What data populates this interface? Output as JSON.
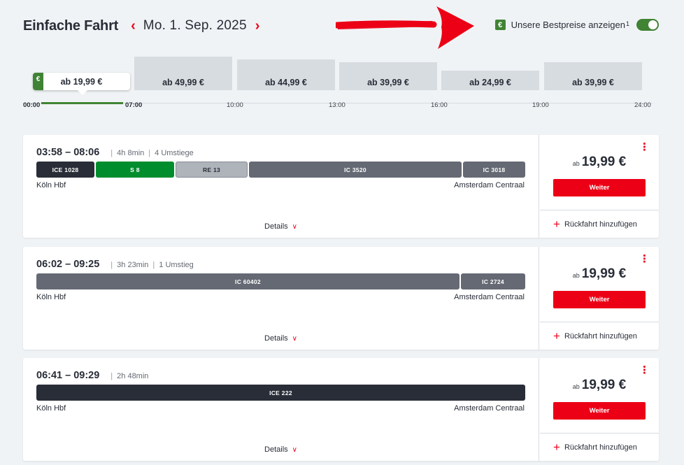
{
  "header": {
    "trip_type": "Einfache Fahrt",
    "date": "Mo. 1. Sep. 2025"
  },
  "bestprice": {
    "label": "Unsere Bestpreise anzeigen",
    "footnote": "1",
    "euro": "€",
    "enabled": true
  },
  "price_bars": [
    {
      "label": "ab 19,99 €",
      "active": true
    },
    {
      "label": "ab 49,99 €"
    },
    {
      "label": "ab 44,99 €"
    },
    {
      "label": "ab 39,99 €"
    },
    {
      "label": "ab 24,99 €"
    },
    {
      "label": "ab 39,99 €"
    }
  ],
  "timeline_ticks": [
    "00:00",
    "07:00",
    "10:00",
    "13:00",
    "16:00",
    "19:00",
    "24:00"
  ],
  "connections": [
    {
      "time": "03:58 – 08:06",
      "duration": "4h 8min",
      "transfers": "4 Umstiege",
      "segments": [
        {
          "name": "ICE 1028",
          "type": "ice"
        },
        {
          "name": "S 8",
          "type": "sb"
        },
        {
          "name": "RE 13",
          "type": "re"
        },
        {
          "name": "IC 3520",
          "type": "ic"
        },
        {
          "name": "IC 3018",
          "type": "ic"
        }
      ],
      "from": "Köln Hbf",
      "to": "Amsterdam Centraal",
      "details": "Details",
      "price_prefix": "ab",
      "price": "19,99 €",
      "button": "Weiter",
      "return": "Rückfahrt hinzufügen"
    },
    {
      "time": "06:02 – 09:25",
      "duration": "3h 23min",
      "transfers": "1 Umstieg",
      "segments": [
        {
          "name": "IC 60402",
          "type": "ic"
        },
        {
          "name": "IC 2724",
          "type": "ic"
        }
      ],
      "from": "Köln Hbf",
      "to": "Amsterdam Centraal",
      "details": "Details",
      "price_prefix": "ab",
      "price": "19,99 €",
      "button": "Weiter",
      "return": "Rückfahrt hinzufügen"
    },
    {
      "time": "06:41 – 09:29",
      "duration": "2h 48min",
      "transfers": "",
      "segments": [
        {
          "name": "ICE 222",
          "type": "ice"
        }
      ],
      "from": "Köln Hbf",
      "to": "Amsterdam Centraal",
      "details": "Details",
      "price_prefix": "ab",
      "price": "19,99 €",
      "button": "Weiter",
      "return": "Rückfahrt hinzufügen"
    }
  ],
  "colors": {
    "db_red": "#ec0016",
    "bestprice_green": "#408335",
    "ice_dark": "#282d37",
    "ic_grey": "#646973",
    "sbahn_green": "#008d2e"
  }
}
